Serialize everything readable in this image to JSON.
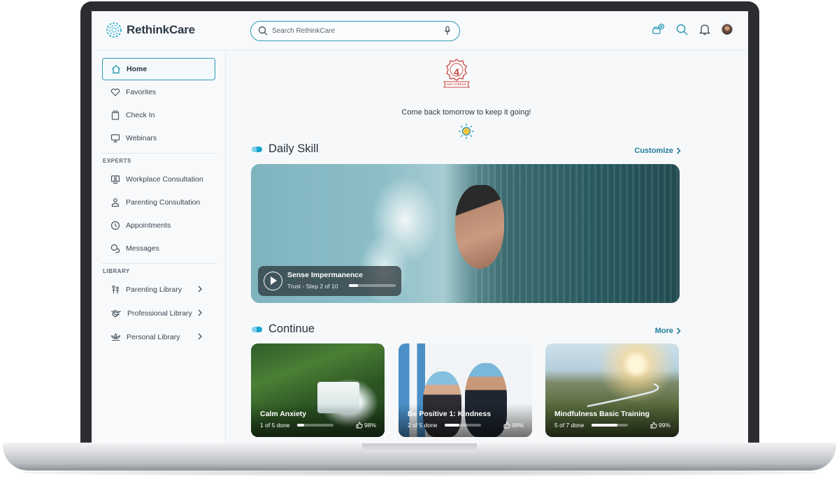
{
  "app": {
    "name_bold": "RethinkCare",
    "logo_alt": "rethinkcare-logo"
  },
  "search": {
    "placeholder": "Search RethinkCare"
  },
  "header_icons": [
    "add-member-icon",
    "search-icon",
    "bell-icon",
    "avatar"
  ],
  "sidebar": {
    "main": [
      {
        "label": "Home",
        "icon": "home-icon",
        "active": true
      },
      {
        "label": "Favorites",
        "icon": "heart-icon"
      },
      {
        "label": "Check In",
        "icon": "clipboard-icon"
      },
      {
        "label": "Webinars",
        "icon": "monitor-icon"
      }
    ],
    "experts_label": "EXPERTS",
    "experts": [
      {
        "label": "Workplace Consultation",
        "icon": "workplace-consult-icon"
      },
      {
        "label": "Parenting Consultation",
        "icon": "parenting-consult-icon"
      },
      {
        "label": "Appointments",
        "icon": "clock-icon"
      },
      {
        "label": "Messages",
        "icon": "chat-icon"
      }
    ],
    "library_label": "LIBRARY",
    "library": [
      {
        "label": "Parenting Library",
        "icon": "parenting-library-icon"
      },
      {
        "label": "Professional Library",
        "icon": "handshake-icon"
      },
      {
        "label": "Personal Library",
        "icon": "lotus-icon"
      }
    ]
  },
  "streak": {
    "number": "4",
    "ribbon": "DAY STREAK",
    "message": "Come back tomorrow to keep it going!"
  },
  "daily_skill": {
    "title": "Daily Skill",
    "link": "Customize",
    "hero": {
      "title": "Sense Impermanence",
      "subtitle": "Trust - Step 2 of 10",
      "progress": 0.2
    }
  },
  "continue": {
    "title": "Continue",
    "link": "More",
    "cards": [
      {
        "title": "Calm Anxiety",
        "progress_text": "1 of 5 done",
        "progress": 0.2,
        "likes": "98%"
      },
      {
        "title": "Be Positive 1: Kindness",
        "progress_text": "2 of 5 done",
        "progress": 0.4,
        "likes": "99%"
      },
      {
        "title": "Mindfulness Basic Training",
        "progress_text": "5 of 7 done",
        "progress": 0.71,
        "likes": "99%"
      }
    ]
  },
  "colors": {
    "accent": "#2e9bb2",
    "link": "#1f7d9a",
    "streak": "#c7433f"
  }
}
